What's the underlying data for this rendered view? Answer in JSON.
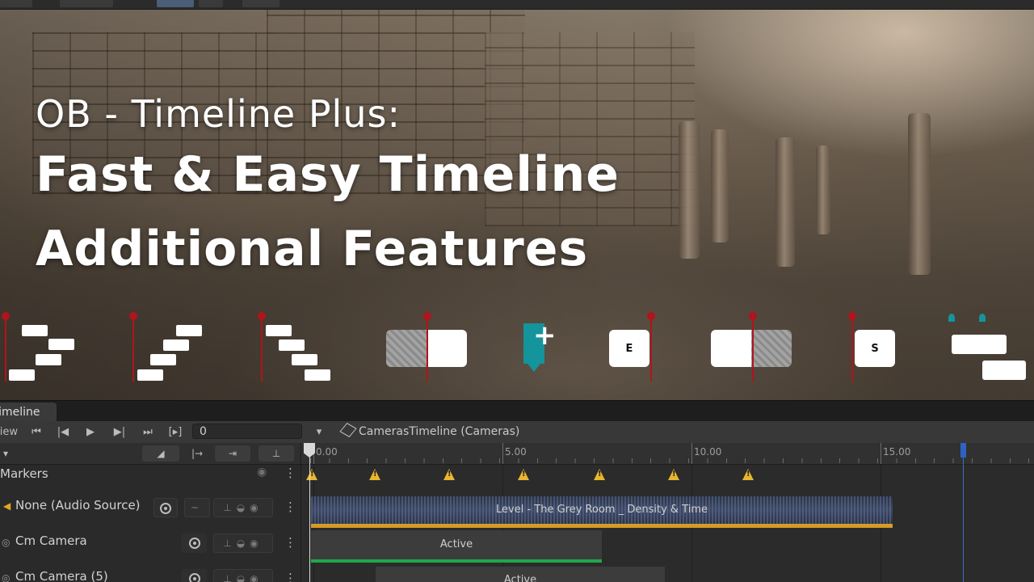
{
  "hero": {
    "title_line1": "OB - Timeline Plus:",
    "title_line2": "Fast & Easy Timeline",
    "title_line3": "Additional Features",
    "feature_key_e": "E",
    "feature_key_s": "S",
    "feature_plus": "+"
  },
  "timeline": {
    "tab_label": "Timeline",
    "preview_label": "Preview",
    "frame_value": "0",
    "breadcrumb": "CamerasTimeline (Cameras)",
    "ruler_labels": [
      "0.00",
      "5.00",
      "10.00",
      "15.00"
    ],
    "markers_label": "Markers",
    "tracks": [
      {
        "label": "None (Audio Source)",
        "clip": "Level - The Grey Room _ Density & Time"
      },
      {
        "label": "Cm Camera",
        "clip": "Active"
      },
      {
        "label": "Cm Camera (5)",
        "clip": "Active"
      }
    ],
    "colors": {
      "playhead_red": "#b0141c",
      "teal": "#14949b",
      "audio_bar": "#d69a27",
      "active_bar": "#1ea84a",
      "end_marker": "#2e63c4",
      "marker_yellow": "#e8b62f"
    }
  }
}
